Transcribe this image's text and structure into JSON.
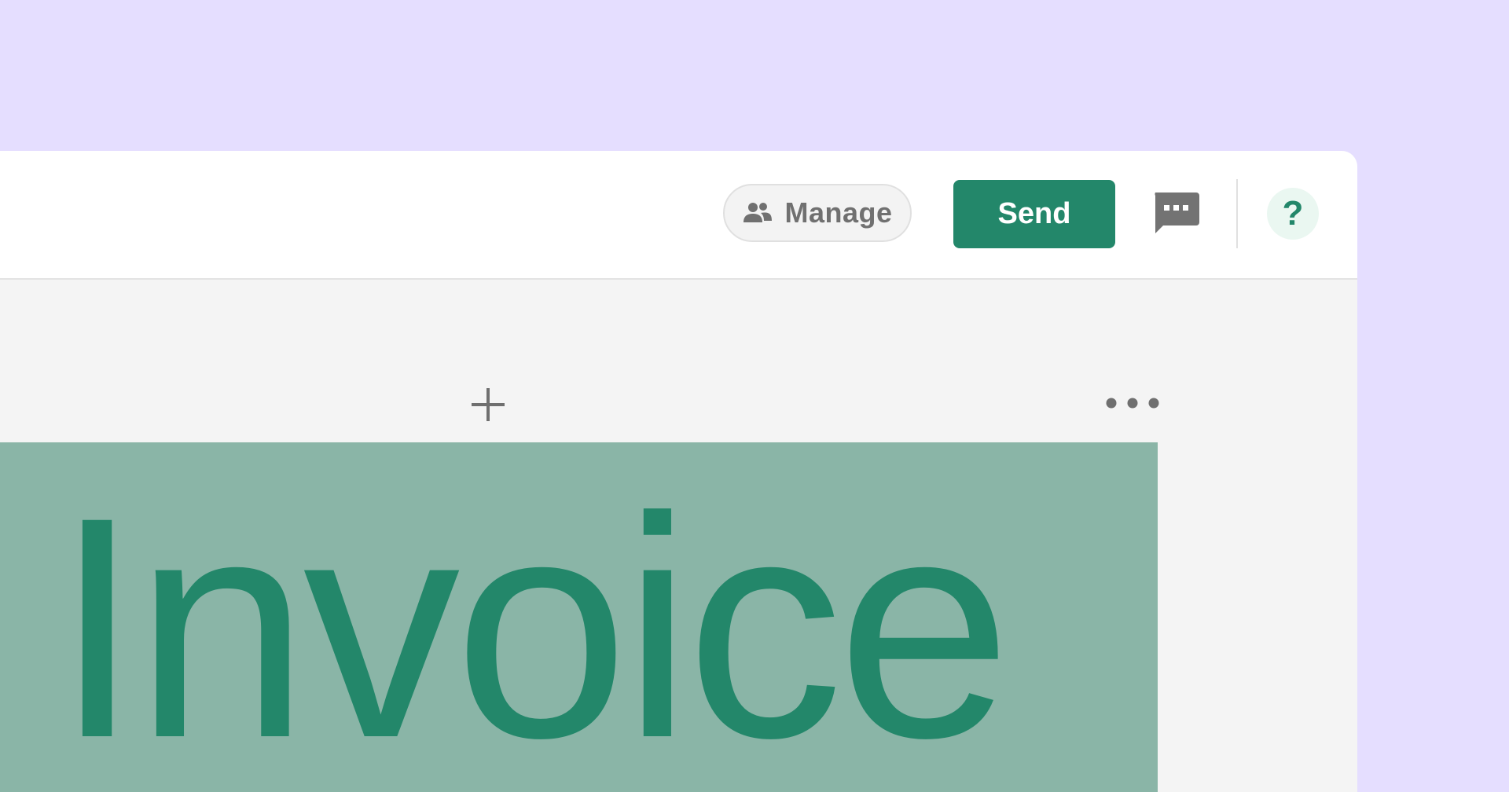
{
  "toolbar": {
    "manage_label": "Manage",
    "manage_icon": "people-icon",
    "send_label": "Send",
    "comments_icon": "comment-icon",
    "help_label": "?"
  },
  "canvas": {
    "add_icon": "plus-icon",
    "more_icon": "more-options-icon",
    "heading": "Invoice"
  },
  "colors": {
    "background": "#E5DEFF",
    "accent": "#23876A",
    "heading_block": "#8AB5A7",
    "canvas": "#F4F4F4"
  }
}
